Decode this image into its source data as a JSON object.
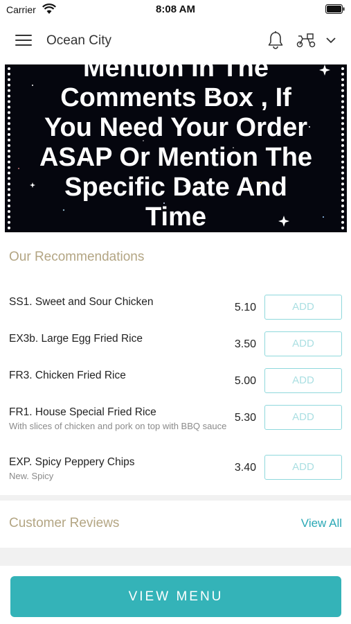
{
  "status_bar": {
    "carrier": "Carrier",
    "time": "8:08 AM"
  },
  "header": {
    "location": "Ocean City",
    "icons": [
      "menu-icon",
      "bell-icon",
      "delivery-icon",
      "chevron-down-icon"
    ]
  },
  "banner": {
    "lines": [
      "Mention In The",
      "Comments Box , If",
      "You Need Your Order",
      "ASAP Or Mention The",
      "Specific Date And",
      "Time"
    ]
  },
  "recommendations": {
    "title": "Our Recommendations",
    "items": [
      {
        "name": "SS1. Sweet and Sour Chicken",
        "description": "",
        "price": "5.10",
        "button": "ADD"
      },
      {
        "name": "EX3b. Large Egg Fried Rice",
        "description": "",
        "price": "3.50",
        "button": "ADD"
      },
      {
        "name": "FR3. Chicken Fried Rice",
        "description": "",
        "price": "5.00",
        "button": "ADD"
      },
      {
        "name": "FR1. House Special Fried Rice",
        "description": "With slices of chicken and pork on top with BBQ sauce",
        "price": "5.30",
        "button": "ADD"
      },
      {
        "name": "EXP. Spicy Peppery Chips",
        "description": "New. Spicy",
        "price": "3.40",
        "button": "ADD"
      }
    ]
  },
  "reviews": {
    "title": "Customer Reviews",
    "view_all": "View All"
  },
  "footer": {
    "view_menu": "VIEW MENU"
  },
  "colors": {
    "accent": "#34b3b8",
    "link": "#2aa8b5",
    "section_title": "#b3a583",
    "add_border": "#8ed8dc"
  }
}
